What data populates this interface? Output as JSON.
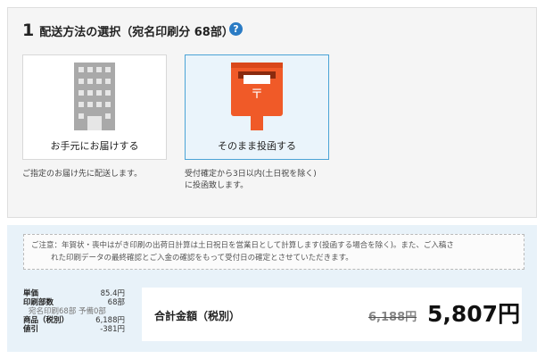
{
  "section": {
    "number": "1",
    "title": "配送方法の選択（宛名印刷分 68部）",
    "help_icon": "question-icon",
    "help_glyph": "?"
  },
  "options": [
    {
      "label": "お手元にお届けする",
      "icon": "building-icon",
      "description_lines": [
        "ご指定のお届け先に配送します。"
      ],
      "selected": false
    },
    {
      "label": "そのまま投函する",
      "icon": "mailbox-icon",
      "description_lines": [
        "受付確定から3日以内(土日祝を除く)",
        "に投函致します。"
      ],
      "selected": true
    }
  ],
  "notice": {
    "line1": "ご注意：年賀状・喪中はがき印刷の出荷日計算は土日祝日を営業日として計算します(投函する場合を除く)。また、ご入稿さ",
    "line2": "れた印刷データの最終確認とご入金の確認をもって受付日の確定とさせていただきます。"
  },
  "breakdown": {
    "unit_price_label": "単価",
    "unit_price_value": "85.4円",
    "print_count_label": "印刷部数",
    "print_count_value": "68部",
    "print_count_sub": "宛名印刷68部 予備0部",
    "goods_label": "商品（税別）",
    "goods_value": "6,188円",
    "discount_label": "値引",
    "discount_value": "-381円"
  },
  "total": {
    "label": "合計金額（税別）",
    "old_price": "6,188円",
    "final_price": "5,807円"
  },
  "colors": {
    "accent_blue": "#2a7bc4",
    "selected_border": "#4aa3d6",
    "selected_bg": "#eaf4fb",
    "mailbox_orange": "#f05a28",
    "bottom_bg": "#e8f2f9"
  }
}
